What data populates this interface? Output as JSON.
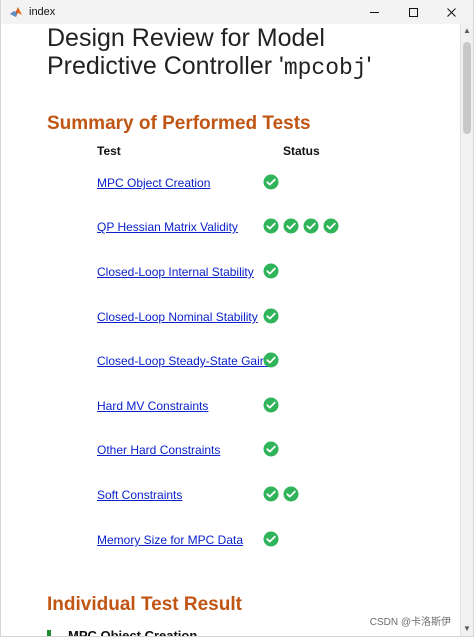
{
  "window": {
    "title": "index",
    "minimize_label": "—",
    "maximize_label": "□",
    "close_label": "×"
  },
  "report": {
    "title_line1": "Design Review for Model",
    "title_line2_prefix": "Predictive Controller '",
    "title_code": "mpcobj",
    "title_line2_suffix": "'",
    "summary_heading": "Summary of Performed Tests",
    "columns": {
      "test": "Test",
      "status": "Status"
    },
    "tests": [
      {
        "name": "MPC Object Creation",
        "passed_checks": 1
      },
      {
        "name": "QP Hessian Matrix Validity",
        "passed_checks": 4
      },
      {
        "name": "Closed-Loop Internal Stability",
        "passed_checks": 1
      },
      {
        "name": "Closed-Loop Nominal Stability",
        "passed_checks": 1
      },
      {
        "name": "Closed-Loop Steady-State Gains",
        "passed_checks": 1
      },
      {
        "name": "Hard MV Constraints",
        "passed_checks": 1
      },
      {
        "name": "Other Hard Constraints",
        "passed_checks": 1
      },
      {
        "name": "Soft Constraints",
        "passed_checks": 2
      },
      {
        "name": "Memory Size for MPC Data",
        "passed_checks": 1
      }
    ],
    "individual_heading": "Individual Test Result",
    "first_result_title": "MPC Object Creation"
  },
  "watermark": "CSDN @卡洛斯伊",
  "colors": {
    "heading": "#c05514",
    "link": "#0b22cc",
    "pass_check": "#2fb45a",
    "result_indicator": "#1d8b2f"
  },
  "icons": {
    "app": "matlab-icon",
    "status": "check-circle-icon"
  }
}
